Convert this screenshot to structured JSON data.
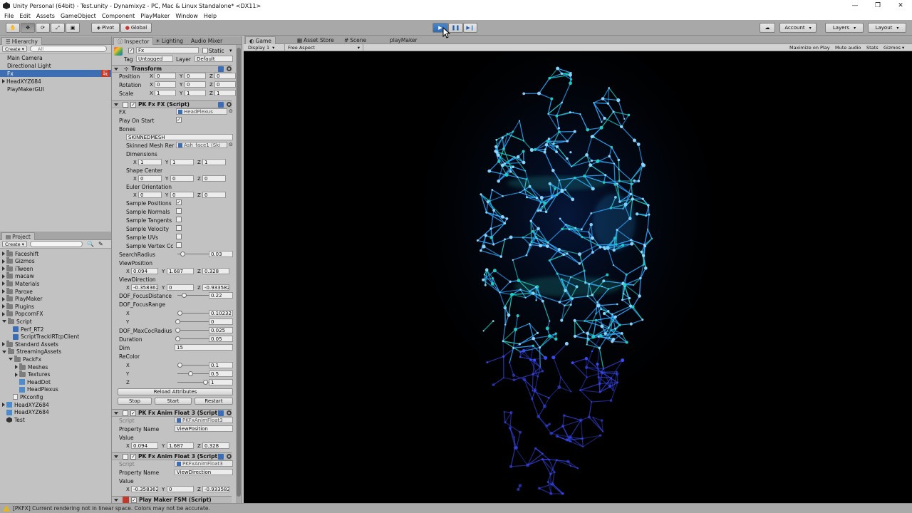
{
  "window": {
    "title": "Unity Personal (64bit) - Test.unity - Dynamixyz - PC, Mac & Linux Standalone* <DX11>",
    "minimize": "—",
    "maximize": "❐",
    "close": "✕"
  },
  "menu": [
    "File",
    "Edit",
    "Assets",
    "GameObject",
    "Component",
    "PlayMaker",
    "Window",
    "Help"
  ],
  "toolbar": {
    "pivot": "Pivot",
    "global": "Global",
    "account": "Account",
    "layers": "Layers",
    "layout": "Layout"
  },
  "hierarchy": {
    "tab": "Hierarchy",
    "create": "Create",
    "search_placeholder": "All",
    "items": [
      "Main Camera",
      "Directional Light",
      "Fx",
      "HeadXYZ684",
      "PlayMakerGUI"
    ],
    "fx_badge": "玩"
  },
  "project": {
    "tab": "Project",
    "create": "Create",
    "items": [
      "Faceshift",
      "Gizmos",
      "iTween",
      "macaw",
      "Materials",
      "Paroxe",
      "PlayMaker",
      "Plugins",
      "PopcornFX",
      "Script",
      "Perf_RT2",
      "ScriptTrackIRTcpClient",
      "Standard Assets",
      "StreamingAssets",
      "PackFx",
      "Meshes",
      "Textures",
      "HeadDot",
      "HeadPlexus",
      "PKconfig",
      "HeadXYZ684",
      "HeadXYZ684",
      "Test"
    ]
  },
  "inspector": {
    "tabs": [
      "Inspector",
      "Lighting",
      "Audio Mixer"
    ],
    "object_name": "Fx",
    "static_label": "Static",
    "tag_label": "Tag",
    "tag_value": "Untagged",
    "layer_label": "Layer",
    "layer_value": "Default",
    "transform": {
      "title": "Transform",
      "position_label": "Position",
      "rotation_label": "Rotation",
      "scale_label": "Scale",
      "position": [
        "0",
        "0",
        "0"
      ],
      "rotation": [
        "0",
        "0",
        "0"
      ],
      "scale": [
        "1",
        "1",
        "1"
      ]
    },
    "pkfx": {
      "title": "PK Fx FX (Script)",
      "fx_label": "FX",
      "fx_value": "HeadPlexus",
      "play_on_start": "Play On Start",
      "bones": "Bones",
      "bones_value": "SKINNEDMESH",
      "skinned_label": "Skinned Mesh Rer",
      "skinned_value": "Ash_face1 (Ski",
      "dimensions": "Dimensions",
      "dimensions_vals": [
        "1",
        "1",
        "1"
      ],
      "shape_center": "Shape Center",
      "shape_center_vals": [
        "0",
        "0",
        "0"
      ],
      "euler": "Euler Orientation",
      "euler_vals": [
        "0",
        "0",
        "0"
      ],
      "sample_positions": "Sample Positions",
      "sample_normals": "Sample Normals",
      "sample_tangents": "Sample Tangents",
      "sample_velocity": "Sample Velocity",
      "sample_uvs": "Sample UVs",
      "sample_vertex": "Sample Vertex Cc",
      "search_radius": "SearchRadius",
      "search_radius_val": "0.03",
      "view_position": "ViewPosition",
      "view_position_vals": [
        "0.094",
        "1.687",
        "0.328"
      ],
      "view_direction": "ViewDirection",
      "view_direction_vals": [
        "-0.358362",
        "0",
        "-0.933582"
      ],
      "dof_focus_distance": "DOF_FocusDistance",
      "dof_focus_distance_val": "0.22",
      "dof_focus_range": "DOF_FocusRange",
      "dof_focus_range_x": "0.10232",
      "dof_focus_range_y": "0",
      "dof_max_coc": "DOF_MaxCocRadius",
      "dof_max_coc_val": "0.025",
      "duration": "Duration",
      "duration_val": "0.05",
      "dim": "Dim",
      "dim_val": "15",
      "recolor": "ReColor",
      "recolor_x": "0.1",
      "recolor_y": "0.5",
      "recolor_z": "1",
      "reload": "Reload Attributes",
      "stop": "Stop",
      "start": "Start",
      "restart": "Restart"
    },
    "anim1": {
      "title": "PK Fx Anim Float 3 (Script)",
      "script_label": "Script",
      "script_value": "PKFxAnimFloat3",
      "prop_label": "Property Name",
      "prop_value": "ViewPosition",
      "value_label": "Value",
      "vals": [
        "0.094",
        "1.687",
        "0.328"
      ]
    },
    "anim2": {
      "title": "PK Fx Anim Float 3 (Script)",
      "script_label": "Script",
      "script_value": "PKFxAnimFloat3",
      "prop_label": "Property Name",
      "prop_value": "ViewDirection",
      "value_label": "Value",
      "vals": [
        "-0.358362",
        "0",
        "-0.933582"
      ]
    },
    "fsm_title": "Play Maker FSM (Script)",
    "axes": [
      "X",
      "Y",
      "Z"
    ]
  },
  "game": {
    "tabs": [
      "Game",
      "Asset Store",
      "Scene",
      "playMaker"
    ],
    "display": "Display 1",
    "aspect": "Free Aspect",
    "options": [
      "Maximize on Play",
      "Mute audio",
      "Stats",
      "Gizmos"
    ]
  },
  "status": {
    "message": "[PKFX] Current rendering not in linear space. Colors may not be accurate."
  },
  "colors": {
    "accent": "#3d6db2",
    "particles_primary": "#2fa8ff",
    "particles_secondary": "#1fd0c8",
    "particles_tertiary": "#3a4dff"
  }
}
